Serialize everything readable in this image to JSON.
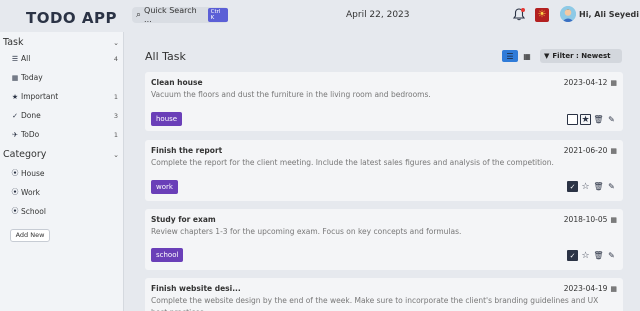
{
  "app": {
    "logo": "TODO APP"
  },
  "header": {
    "search_label": "Quick Search ...",
    "search_shortcut": "Ctrl K",
    "date": "April 22, 2023",
    "greeting": "Hi, Ali Seyedi"
  },
  "sidebar": {
    "task_section": "Task",
    "task_items": [
      {
        "label": "All",
        "icon": "list-icon",
        "count": "4"
      },
      {
        "label": "Today",
        "icon": "calendar-icon",
        "count": ""
      },
      {
        "label": "Important",
        "icon": "star-icon",
        "count": "1"
      },
      {
        "label": "Done",
        "icon": "check-double-icon",
        "count": "3"
      },
      {
        "label": "ToDo",
        "icon": "plane-icon",
        "count": "1"
      }
    ],
    "category_section": "Category",
    "category_items": [
      {
        "label": "House",
        "icon": "circle-icon"
      },
      {
        "label": "Work",
        "icon": "circle-icon"
      },
      {
        "label": "School",
        "icon": "circle-icon"
      }
    ],
    "add_new": "Add New"
  },
  "main": {
    "title": "All Task",
    "filter_label": "Filter : Newest",
    "tasks": [
      {
        "title": "Clean house",
        "description": "Vacuum the floors and dust the furniture in the living room and bedrooms.",
        "date": "2023-04-12",
        "tag": "house",
        "done": false,
        "important": true
      },
      {
        "title": "Finish the report",
        "description": "Complete the report for the client meeting. Include the latest sales figures and analysis of the competition.",
        "date": "2021-06-20",
        "tag": "work",
        "done": true,
        "important": false
      },
      {
        "title": "Study for exam",
        "description": "Review chapters 1-3 for the upcoming exam. Focus on key concepts and formulas.",
        "date": "2018-10-05",
        "tag": "school",
        "done": true,
        "important": false
      },
      {
        "title": "Finish website desi...",
        "description": "Complete the website design by the end of the week. Make sure to incorporate the client's branding guidelines and UX best practices.",
        "date": "2023-04-19",
        "tag": "",
        "done": false,
        "important": false
      }
    ]
  },
  "colors": {
    "accent": "#2f7bd8",
    "tag": "#6a3fb8",
    "dark": "#2b3345",
    "bg": "#e6e9ee"
  }
}
